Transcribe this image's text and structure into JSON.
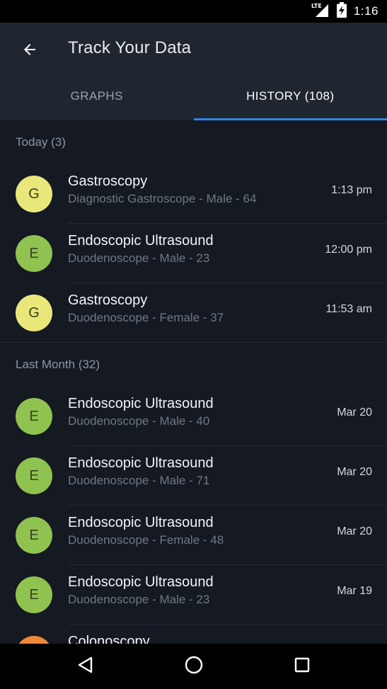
{
  "status_bar": {
    "network_label": "LTE",
    "time": "1:16"
  },
  "app_bar": {
    "title": "Track Your Data"
  },
  "tabs": [
    {
      "label": "GRAPHS",
      "active": false
    },
    {
      "label": "HISTORY (108)",
      "active": true
    }
  ],
  "colors": {
    "accent": "#2f86e6",
    "avatar_g": "#e9e77a",
    "avatar_e": "#8fc24f",
    "avatar_c": "#f0883a"
  },
  "sections": [
    {
      "header": "Today (3)",
      "items": [
        {
          "initial": "G",
          "title": "Gastroscopy",
          "subtitle": "Diagnostic Gastroscope - Male - 64",
          "time": "1:13 pm"
        },
        {
          "initial": "E",
          "title": "Endoscopic Ultrasound",
          "subtitle": "Duodenoscope - Male - 23",
          "time": "12:00 pm"
        },
        {
          "initial": "G",
          "title": "Gastroscopy",
          "subtitle": "Duodenoscope - Female - 37",
          "time": "11:53 am"
        }
      ]
    },
    {
      "header": "Last Month (32)",
      "items": [
        {
          "initial": "E",
          "title": "Endoscopic Ultrasound",
          "subtitle": "Duodenoscope - Male - 40",
          "time": "Mar 20"
        },
        {
          "initial": "E",
          "title": "Endoscopic Ultrasound",
          "subtitle": "Duodenoscope - Male - 71",
          "time": "Mar 20"
        },
        {
          "initial": "E",
          "title": "Endoscopic Ultrasound",
          "subtitle": "Duodenoscope - Female - 48",
          "time": "Mar 20"
        },
        {
          "initial": "E",
          "title": "Endoscopic Ultrasound",
          "subtitle": "Duodenoscope - Male - 23",
          "time": "Mar 19"
        },
        {
          "initial": "",
          "title": "Colonoscopy",
          "subtitle": "",
          "time": ""
        }
      ]
    }
  ],
  "icons": {
    "back": "arrow-back-icon",
    "signal": "signal-icon",
    "battery": "battery-charging-icon",
    "nav_back": "triangle-back-icon",
    "nav_home": "circle-home-icon",
    "nav_recents": "square-recents-icon"
  }
}
